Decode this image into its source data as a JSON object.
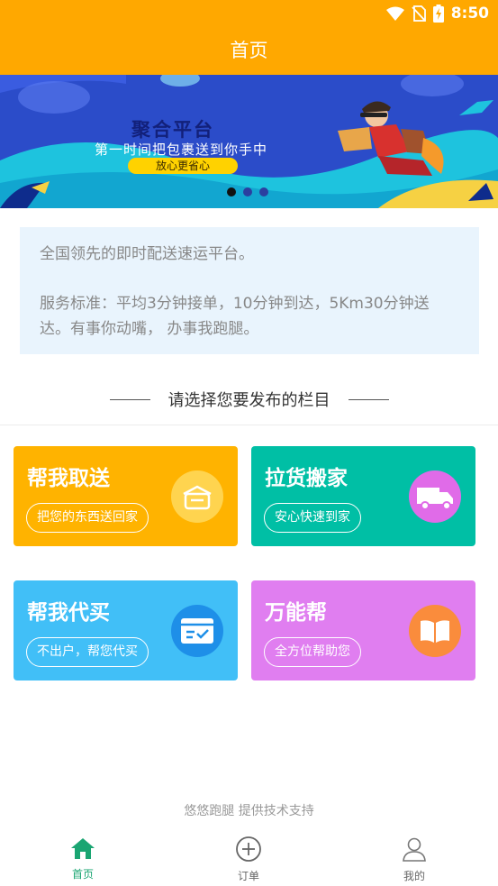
{
  "status_bar": {
    "time": "8:50",
    "icons": [
      "wifi-icon",
      "no-sim-icon",
      "battery-charging-icon"
    ]
  },
  "header": {
    "title": "首页"
  },
  "banner": {
    "title": "聚合平台",
    "subtitle": "第一时间把包裹送到你手中",
    "button": "放心更省心",
    "slide_count": 3,
    "active_slide": 1
  },
  "intro": {
    "line1": "全国领先的即时配送速运平台。",
    "line2": "服务标准：平均3分钟接单，10分钟到达，5Km30分钟送达。有事你动嘴， 办事我跑腿。"
  },
  "section": {
    "heading": "请选择您要发布的栏目"
  },
  "services": [
    {
      "title": "帮我取送",
      "button": "把您的东西送回家",
      "color": "#FFB300",
      "icon": "parcel-box-icon"
    },
    {
      "title": "拉货搬家",
      "button": "安心快速到家",
      "color": "#00BFA5",
      "icon": "truck-icon"
    },
    {
      "title": "帮我代买",
      "button": "不出户，帮您代买",
      "color": "#41BFF7",
      "icon": "shopping-check-icon"
    },
    {
      "title": "万能帮",
      "button": "全方位帮助您",
      "color": "#E07EF0",
      "icon": "open-book-icon"
    }
  ],
  "footer": {
    "powered_by": "悠悠跑腿 提供技术支持"
  },
  "tabbar": {
    "active_color": "#1AA572",
    "items": [
      {
        "label": "首页",
        "icon": "home-icon",
        "active": true
      },
      {
        "label": "订单",
        "icon": "add-circle-icon",
        "active": false
      },
      {
        "label": "我的",
        "icon": "user-icon",
        "active": false
      }
    ]
  }
}
